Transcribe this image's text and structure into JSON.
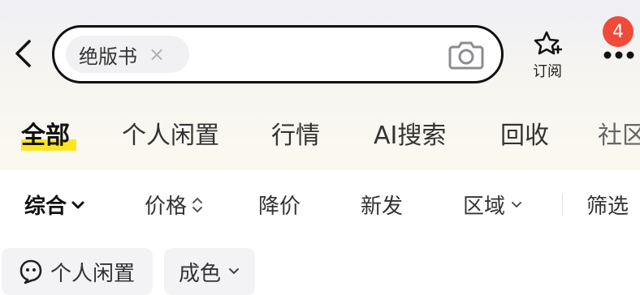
{
  "header": {
    "back_icon": "chevron-left-icon",
    "search": {
      "chip_text": "绝版书",
      "chip_close": "×",
      "camera_icon": "camera-icon"
    },
    "subscribe_label": "订阅",
    "subscribe_icon": "star-plus-icon",
    "more_icon": "more-dots-icon",
    "badge_count": "4"
  },
  "tabs": [
    {
      "label": "全部",
      "active": true
    },
    {
      "label": "个人闲置"
    },
    {
      "label": "行情"
    },
    {
      "label": "AI搜索"
    },
    {
      "label": "回收"
    },
    {
      "label": "社区"
    }
  ],
  "filters": [
    {
      "label": "综合",
      "icon": "chevron-down-icon",
      "active": true
    },
    {
      "label": "价格",
      "icon": "sort-icon"
    },
    {
      "label": "降价"
    },
    {
      "label": "新发"
    },
    {
      "label": "区域",
      "icon": "chevron-down-icon"
    },
    {
      "label": "筛选"
    }
  ],
  "pills": [
    {
      "label": "个人闲置",
      "icon": "person-face-icon"
    },
    {
      "label": "成色",
      "icon": "chevron-down-icon"
    }
  ],
  "colors": {
    "accent": "#ffe521",
    "badge": "#f04a3a"
  }
}
